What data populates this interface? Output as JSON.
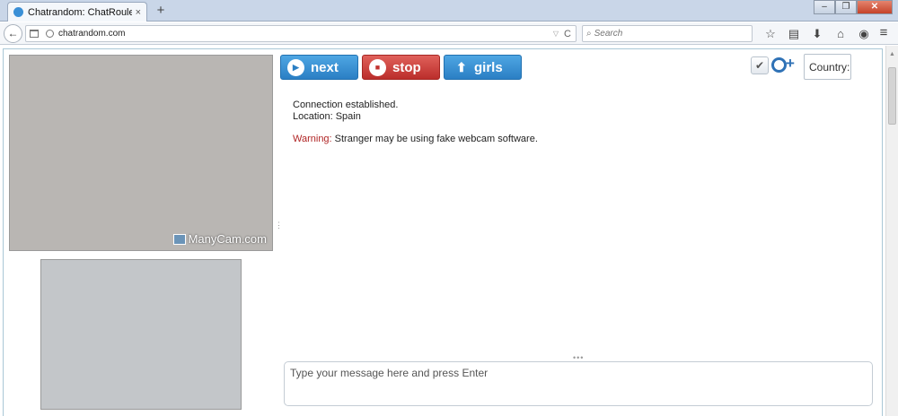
{
  "browser": {
    "tab_title": "Chatrandom: ChatRoulette...",
    "tab_close": "×",
    "new_tab": "+",
    "win_min": "–",
    "win_max": "❐",
    "win_close": "✕",
    "back": "←",
    "url": "chatrandom.com",
    "url_dropdown": "▽",
    "url_reload": "C",
    "search_placeholder": "Search",
    "search_glyph": "⌕",
    "icon_bookmark": "☆",
    "icon_reader": "▤",
    "icon_download": "⬇",
    "icon_home": "⌂",
    "icon_addon": "◉",
    "icon_menu": "≡"
  },
  "video": {
    "watermark": "ManyCam.com"
  },
  "controls": {
    "next_label": "next",
    "next_glyph": "▶",
    "stop_label": "stop",
    "stop_glyph": "■",
    "girls_label": "girls",
    "girls_glyph": "⬆",
    "check_glyph": "✔",
    "addcam_glyph": "+",
    "country_label": "Country:"
  },
  "chat": {
    "line1": "Connection established.",
    "line2": "Location: Spain",
    "warning_label": "Warning:",
    "warning_text": " Stranger may be using fake webcam software.",
    "splitter": "•••",
    "input_placeholder": "Type your message here and press Enter"
  },
  "colors": {
    "next": "#2b7fc4",
    "stop": "#bb2e2b",
    "warning": "#b02424"
  }
}
